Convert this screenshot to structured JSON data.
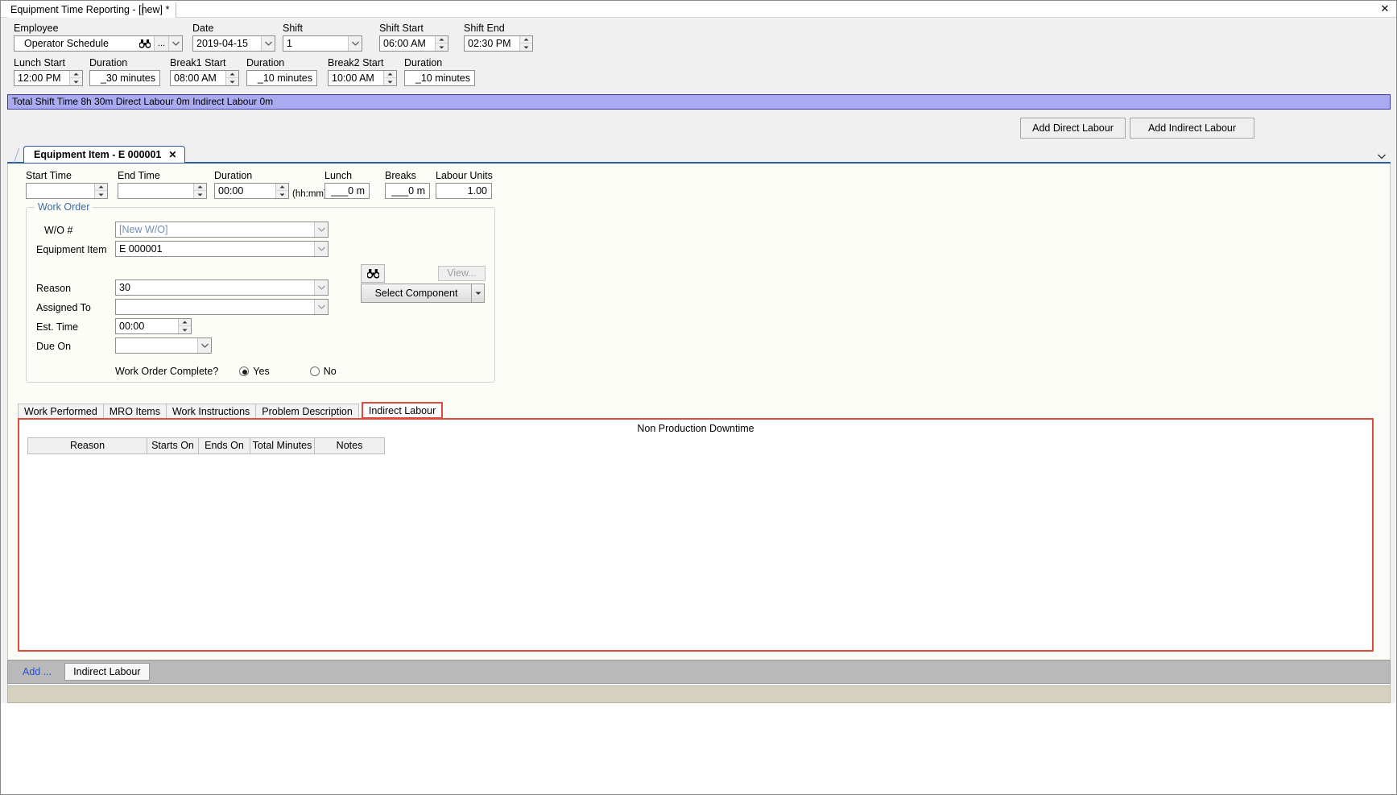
{
  "window": {
    "doc_tab_title": "Equipment Time Reporting - [new] *",
    "close_icon": "close-icon"
  },
  "header": {
    "employee": {
      "label": "Employee",
      "value": "Operator Schedule",
      "binoculars_icon": "binoculars-icon",
      "ellipsis_label": "...",
      "dropdown_icon": "chevron-down-icon"
    },
    "date": {
      "label": "Date",
      "value": "2019-04-15"
    },
    "shift": {
      "label": "Shift",
      "value": "1"
    },
    "shift_start": {
      "label": "Shift Start",
      "value": "06:00 AM"
    },
    "shift_end": {
      "label": "Shift End",
      "value": "02:30 PM"
    },
    "lunch_start": {
      "label": "Lunch Start",
      "value": "12:00 PM"
    },
    "lunch_duration": {
      "label": "Duration",
      "value": "_30 minutes"
    },
    "break1_start": {
      "label": "Break1 Start",
      "value": "08:00 AM"
    },
    "break1_duration": {
      "label": "Duration",
      "value": "_10 minutes"
    },
    "break2_start": {
      "label": "Break2 Start",
      "value": "10:00 AM"
    },
    "break2_duration": {
      "label": "Duration",
      "value": "_10 minutes"
    }
  },
  "status_strip": {
    "text": "Total Shift Time 8h 30m  Direct Labour 0m  Indirect Labour 0m",
    "background_color": "#aaaaf0",
    "border_color": "#3a3a9e"
  },
  "actions": {
    "add_direct_labour": "Add Direct Labour",
    "add_indirect_labour": "Add Indirect Labour"
  },
  "item_tab": {
    "label": "Equipment Item - E 000001",
    "close_icon": "close-icon",
    "overflow_icon": "chevron-down-icon"
  },
  "entry": {
    "start_time": {
      "label": "Start Time",
      "value": ""
    },
    "end_time": {
      "label": "End Time",
      "value": ""
    },
    "duration": {
      "label": "Duration",
      "value": "00:00",
      "hint": "(hh:mm)"
    },
    "lunch": {
      "label": "Lunch",
      "value": "___0 m"
    },
    "breaks": {
      "label": "Breaks",
      "value": "___0 m"
    },
    "labour_units": {
      "label": "Labour Units",
      "value": "1.00"
    }
  },
  "work_order": {
    "title": "Work Order",
    "wo_number": {
      "label": "W/O #",
      "value": "[New W/O]",
      "value_color": "#6e8fb5"
    },
    "equipment_item": {
      "label": "Equipment Item",
      "value": "E 000001"
    },
    "search_icon": "binoculars-icon",
    "view_button": "View...",
    "select_component_button": "Select Component",
    "select_component_arrow_icon": "chevron-down-icon",
    "reason": {
      "label": "Reason",
      "value": "30"
    },
    "assigned_to": {
      "label": "Assigned To",
      "value": ""
    },
    "est_time": {
      "label": "Est. Time",
      "value": "00:00"
    },
    "due_on": {
      "label": "Due On",
      "value": ""
    },
    "complete": {
      "label": "Work Order Complete?",
      "yes_label": "Yes",
      "no_label": "No",
      "selected": "Yes"
    }
  },
  "bottom_tabs": {
    "items": [
      {
        "label": "Work Performed",
        "selected": false
      },
      {
        "label": "MRO Items",
        "selected": false
      },
      {
        "label": "Work Instructions",
        "selected": false
      },
      {
        "label": "Problem Description",
        "selected": false
      },
      {
        "label": "Indirect Labour",
        "selected": true
      }
    ],
    "highlight_color": "#e04a3f"
  },
  "grid": {
    "caption": "Non Production Downtime",
    "columns": [
      "Reason",
      "Starts On",
      "Ends On",
      "Total Minutes",
      "Notes"
    ],
    "rows": []
  },
  "footer": {
    "add_link": "Add ...",
    "indirect_labour_button": "Indirect Labour"
  }
}
